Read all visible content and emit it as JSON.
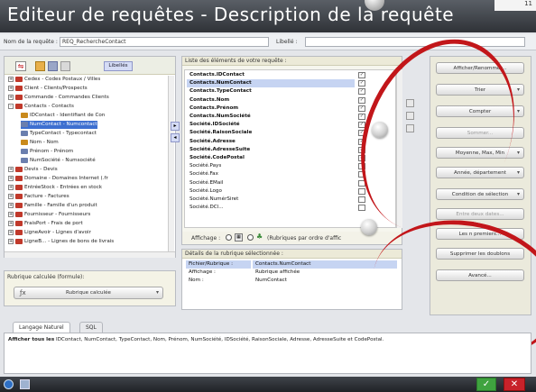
{
  "window": {
    "title": "Editeur de requêtes - Description de la requête",
    "corner_text": "11"
  },
  "header_row": {
    "name_label": "Nom de la requête :",
    "name_value": "REQ_RechercheContact",
    "libelle_label": "Libellé :",
    "libelle_value": ""
  },
  "tree": {
    "toolbar_button": "Libellés",
    "items": [
      {
        "label": "Cedex - Codes Postaux / Villes",
        "level": 0,
        "pm": "+",
        "color": "#c0392b"
      },
      {
        "label": "Client - Clients/Prospects",
        "level": 0,
        "pm": "+",
        "color": "#c0392b"
      },
      {
        "label": "Commande - Commandes Clients",
        "level": 0,
        "pm": "+",
        "color": "#c0392b"
      },
      {
        "label": "Contacts - Contacts",
        "level": 0,
        "pm": "-",
        "color": "#c0392b"
      },
      {
        "label": "IDContact - Identifiant de Con",
        "level": 1,
        "pm": "",
        "color": "#c98a1c"
      },
      {
        "label": "NumContact - Numcontact",
        "level": 1,
        "pm": "",
        "color": "#6b7fae"
      },
      {
        "label": "TypeContact - Typecontact",
        "level": 1,
        "pm": "",
        "color": "#6b7fae"
      },
      {
        "label": "Nom - Nom",
        "level": 1,
        "pm": "",
        "color": "#c98a1c"
      },
      {
        "label": "Prénom - Prénom",
        "level": 1,
        "pm": "",
        "color": "#6b7fae"
      },
      {
        "label": "NumSociété - Numsociété",
        "level": 1,
        "pm": "",
        "color": "#6b7fae"
      },
      {
        "label": "Devis - Devis",
        "level": 0,
        "pm": "+",
        "color": "#c0392b"
      },
      {
        "label": "Domaine - Domaines Internet (.fr",
        "level": 0,
        "pm": "+",
        "color": "#c0392b"
      },
      {
        "label": "EntréeStock - Entrées en stock",
        "level": 0,
        "pm": "+",
        "color": "#c0392b"
      },
      {
        "label": "Facture - Factures",
        "level": 0,
        "pm": "+",
        "color": "#c0392b"
      },
      {
        "label": "Famille - Famille d'un produit",
        "level": 0,
        "pm": "+",
        "color": "#c0392b"
      },
      {
        "label": "Fournisseur - Fournisseurs",
        "level": 0,
        "pm": "+",
        "color": "#c0392b"
      },
      {
        "label": "FraisPort - Frais de port",
        "level": 0,
        "pm": "+",
        "color": "#c0392b"
      },
      {
        "label": "LigneAvoir - Lignes d'avoir",
        "level": 0,
        "pm": "+",
        "color": "#c0392b"
      },
      {
        "label": "LigneB... - Lignes de bons de livrais",
        "level": 0,
        "pm": "+",
        "color": "#c0392b"
      }
    ],
    "selected_index": 5,
    "calc_section_label": "Rubrique calculée (formule):",
    "calc_button": "Rubrique calculée"
  },
  "elements": {
    "header": "Liste des éléments de votre requête :",
    "rows": [
      {
        "label": "Contacts.IDContact",
        "bold": true,
        "checked": true
      },
      {
        "label": "Contacts.NumContact",
        "bold": true,
        "checked": true
      },
      {
        "label": "Contacts.TypeContact",
        "bold": true,
        "checked": true
      },
      {
        "label": "Contacts.Nom",
        "bold": true,
        "checked": true
      },
      {
        "label": "Contacts.Prénom",
        "bold": true,
        "checked": true
      },
      {
        "label": "Contacts.NumSociété",
        "bold": true,
        "checked": true
      },
      {
        "label": "Société.IDSociété",
        "bold": true,
        "checked": true
      },
      {
        "label": "Société.RaisonSociale",
        "bold": true,
        "checked": true
      },
      {
        "label": "Société.Adresse",
        "bold": true,
        "checked": true
      },
      {
        "label": "Société.AdresseSuite",
        "bold": true,
        "checked": true
      },
      {
        "label": "Société.CodePostal",
        "bold": true,
        "checked": true
      },
      {
        "label": "Société.Pays",
        "bold": false,
        "checked": false
      },
      {
        "label": "Société.Fax",
        "bold": false,
        "checked": false
      },
      {
        "label": "Société.EMail",
        "bold": false,
        "checked": false
      },
      {
        "label": "Société.Logo",
        "bold": false,
        "checked": false
      },
      {
        "label": "Société.NumérSiret",
        "bold": false,
        "checked": false
      },
      {
        "label": "Société.DCl...",
        "bold": false,
        "checked": false
      }
    ],
    "selected_index": 1,
    "display_label": "Affichage :",
    "display_option": "(Rubriques par ordre d'affic"
  },
  "details": {
    "header": "Détails de la rubrique sélectionnée :",
    "rows": [
      {
        "k": "Fichier/Rubrique :",
        "v": "Contacts.NumContact"
      },
      {
        "k": "Affichage :",
        "v": "Rubrique affichée"
      },
      {
        "k": "Nom :",
        "v": "NumContact"
      }
    ]
  },
  "actions": {
    "buttons": [
      {
        "label": "Afficher/Renommer...",
        "disabled": false,
        "dropdown": false
      },
      {
        "label": "Trier",
        "disabled": false,
        "dropdown": true
      },
      {
        "label": "Compter",
        "disabled": false,
        "dropdown": true
      },
      {
        "label": "Sommer...",
        "disabled": true,
        "dropdown": false
      },
      {
        "label": "Moyenne, Max, Min",
        "disabled": false,
        "dropdown": true
      },
      {
        "label": "Année, département",
        "disabled": false,
        "dropdown": true
      },
      {
        "label": "Condition de sélection",
        "disabled": false,
        "dropdown": true
      },
      {
        "label": "Entre deux dates...",
        "disabled": true,
        "dropdown": false
      },
      {
        "label": "Les n premiers...",
        "disabled": false,
        "dropdown": false
      },
      {
        "label": "Supprimer les doublons",
        "disabled": false,
        "dropdown": false
      },
      {
        "label": "Avancé...",
        "disabled": false,
        "dropdown": false
      }
    ]
  },
  "tabs": [
    {
      "label": "Langage Naturel",
      "active": true
    },
    {
      "label": "SQL",
      "active": false
    }
  ],
  "natural_language": {
    "prefix": "Afficher tous les",
    "text": "IDContact, NumContact, TypeContact, Nom, Prénom, NumSociété, IDSociété, RaisonSociale, Adresse, AdresseSuite et CodePostal."
  },
  "colors": {
    "accent_red": "#c2161a",
    "selection_blue": "#3d6fd0",
    "ok_green": "#3fa33f",
    "cancel_red": "#c8222a"
  }
}
